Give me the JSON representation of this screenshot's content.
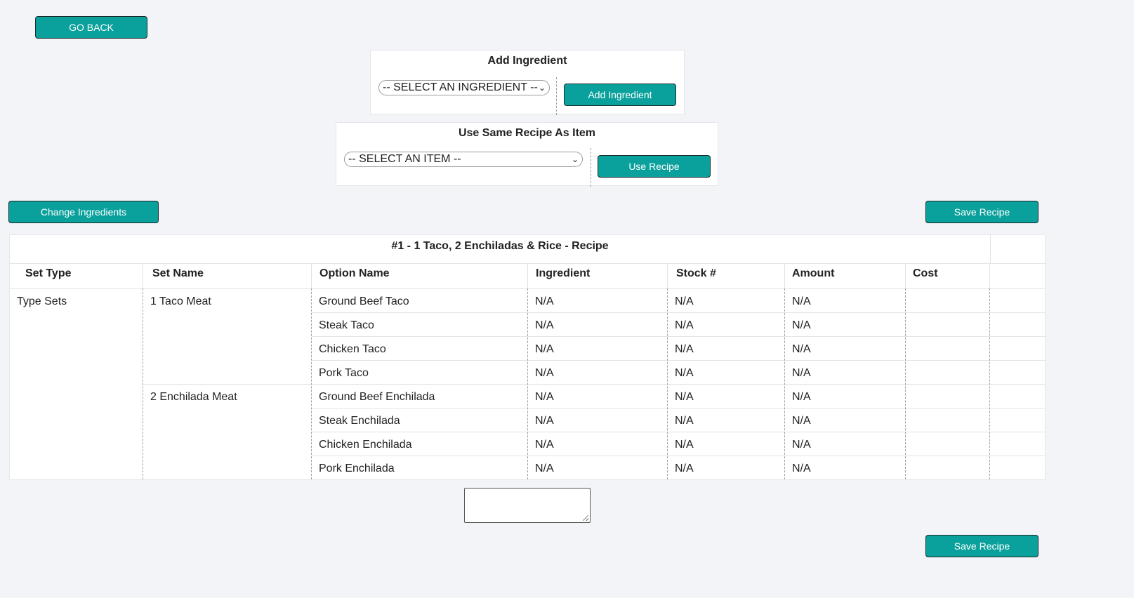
{
  "buttons": {
    "go_back": "GO BACK",
    "add_ingredient": "Add Ingredient",
    "use_recipe": "Use Recipe",
    "change_ingredients": "Change Ingredients",
    "save_recipe_top": "Save Recipe",
    "save_recipe_bottom": "Save Recipe"
  },
  "add_ingredient_panel": {
    "title": "Add Ingredient",
    "select_value": "-- SELECT AN INGREDIENT --"
  },
  "same_recipe_panel": {
    "title": "Use Same Recipe As Item",
    "select_value": "-- SELECT AN ITEM --"
  },
  "recipe": {
    "title": "#1 - 1 Taco, 2 Enchiladas & Rice - Recipe",
    "headers": [
      "Set Type",
      "Set Name",
      "Option Name",
      "Ingredient",
      "Stock #",
      "Amount",
      "Cost"
    ],
    "set_type": "Type Sets",
    "sets": [
      {
        "name": "1 Taco Meat",
        "rows": [
          {
            "option": "Ground Beef Taco",
            "ingredient": "N/A",
            "stock": "N/A",
            "amount": "N/A",
            "cost": ""
          },
          {
            "option": "Steak Taco",
            "ingredient": "N/A",
            "stock": "N/A",
            "amount": "N/A",
            "cost": ""
          },
          {
            "option": "Chicken Taco",
            "ingredient": "N/A",
            "stock": "N/A",
            "amount": "N/A",
            "cost": ""
          },
          {
            "option": "Pork Taco",
            "ingredient": "N/A",
            "stock": "N/A",
            "amount": "N/A",
            "cost": ""
          }
        ]
      },
      {
        "name": "2 Enchilada Meat",
        "rows": [
          {
            "option": "Ground Beef Enchilada",
            "ingredient": "N/A",
            "stock": "N/A",
            "amount": "N/A",
            "cost": ""
          },
          {
            "option": "Steak Enchilada",
            "ingredient": "N/A",
            "stock": "N/A",
            "amount": "N/A",
            "cost": ""
          },
          {
            "option": "Chicken Enchilada",
            "ingredient": "N/A",
            "stock": "N/A",
            "amount": "N/A",
            "cost": ""
          },
          {
            "option": "Pork Enchilada",
            "ingredient": "N/A",
            "stock": "N/A",
            "amount": "N/A",
            "cost": ""
          }
        ]
      }
    ]
  },
  "notes": {
    "value": ""
  },
  "colors": {
    "accent": "#0aa19c",
    "background": "#f3f4f7"
  }
}
